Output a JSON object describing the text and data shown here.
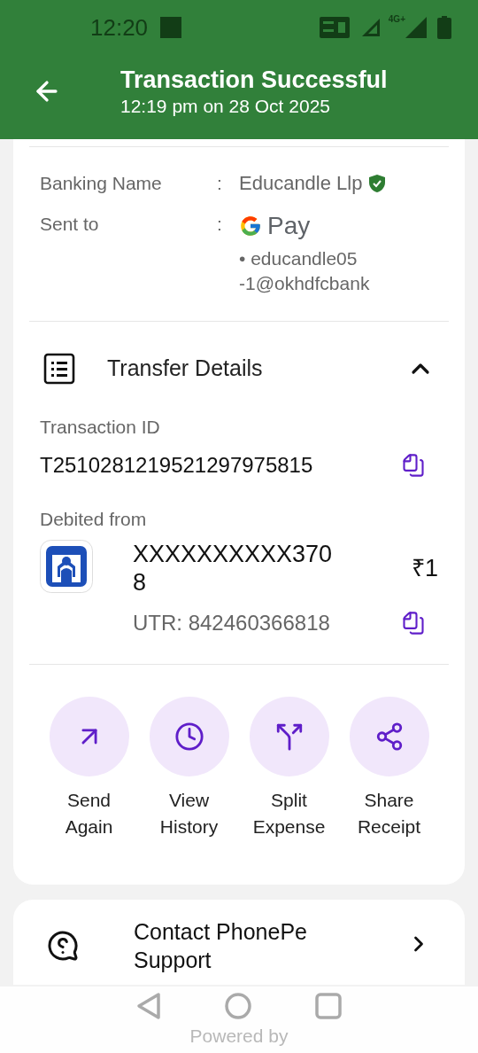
{
  "status_bar": {
    "time": "12:20",
    "network": "4G+"
  },
  "header": {
    "title": "Transaction Successful",
    "subtitle": "12:19 pm on 28 Oct 2025"
  },
  "recipient": [
    {
      "kind": "name",
      "label": "Banking Name",
      "separator": ":",
      "value": "Educandle Llp",
      "verified": true
    },
    {
      "kind": "upi",
      "label": "Sent to",
      "separator": ":",
      "app": "Pay",
      "upi_lines": [
        "• educandle05",
        "-1@okhdfcbank"
      ]
    }
  ],
  "transfer": {
    "title": "Transfer Details",
    "expanded": true,
    "transaction_id_label": "Transaction ID",
    "transaction_id": "T2510281219521297975815",
    "debited_label": "Debited from",
    "account": "XXXXXXXXXX3708",
    "amount": "₹1",
    "utr": "UTR: 842460366818"
  },
  "actions": [
    {
      "kind": "send",
      "label": "Send Again"
    },
    {
      "kind": "history",
      "label": "View History"
    },
    {
      "kind": "split",
      "label": "Split Expense"
    },
    {
      "kind": "share",
      "label": "Share Receipt"
    }
  ],
  "support": {
    "label": "Contact PhonePe Support"
  },
  "footer": {
    "text": "Powered by"
  }
}
